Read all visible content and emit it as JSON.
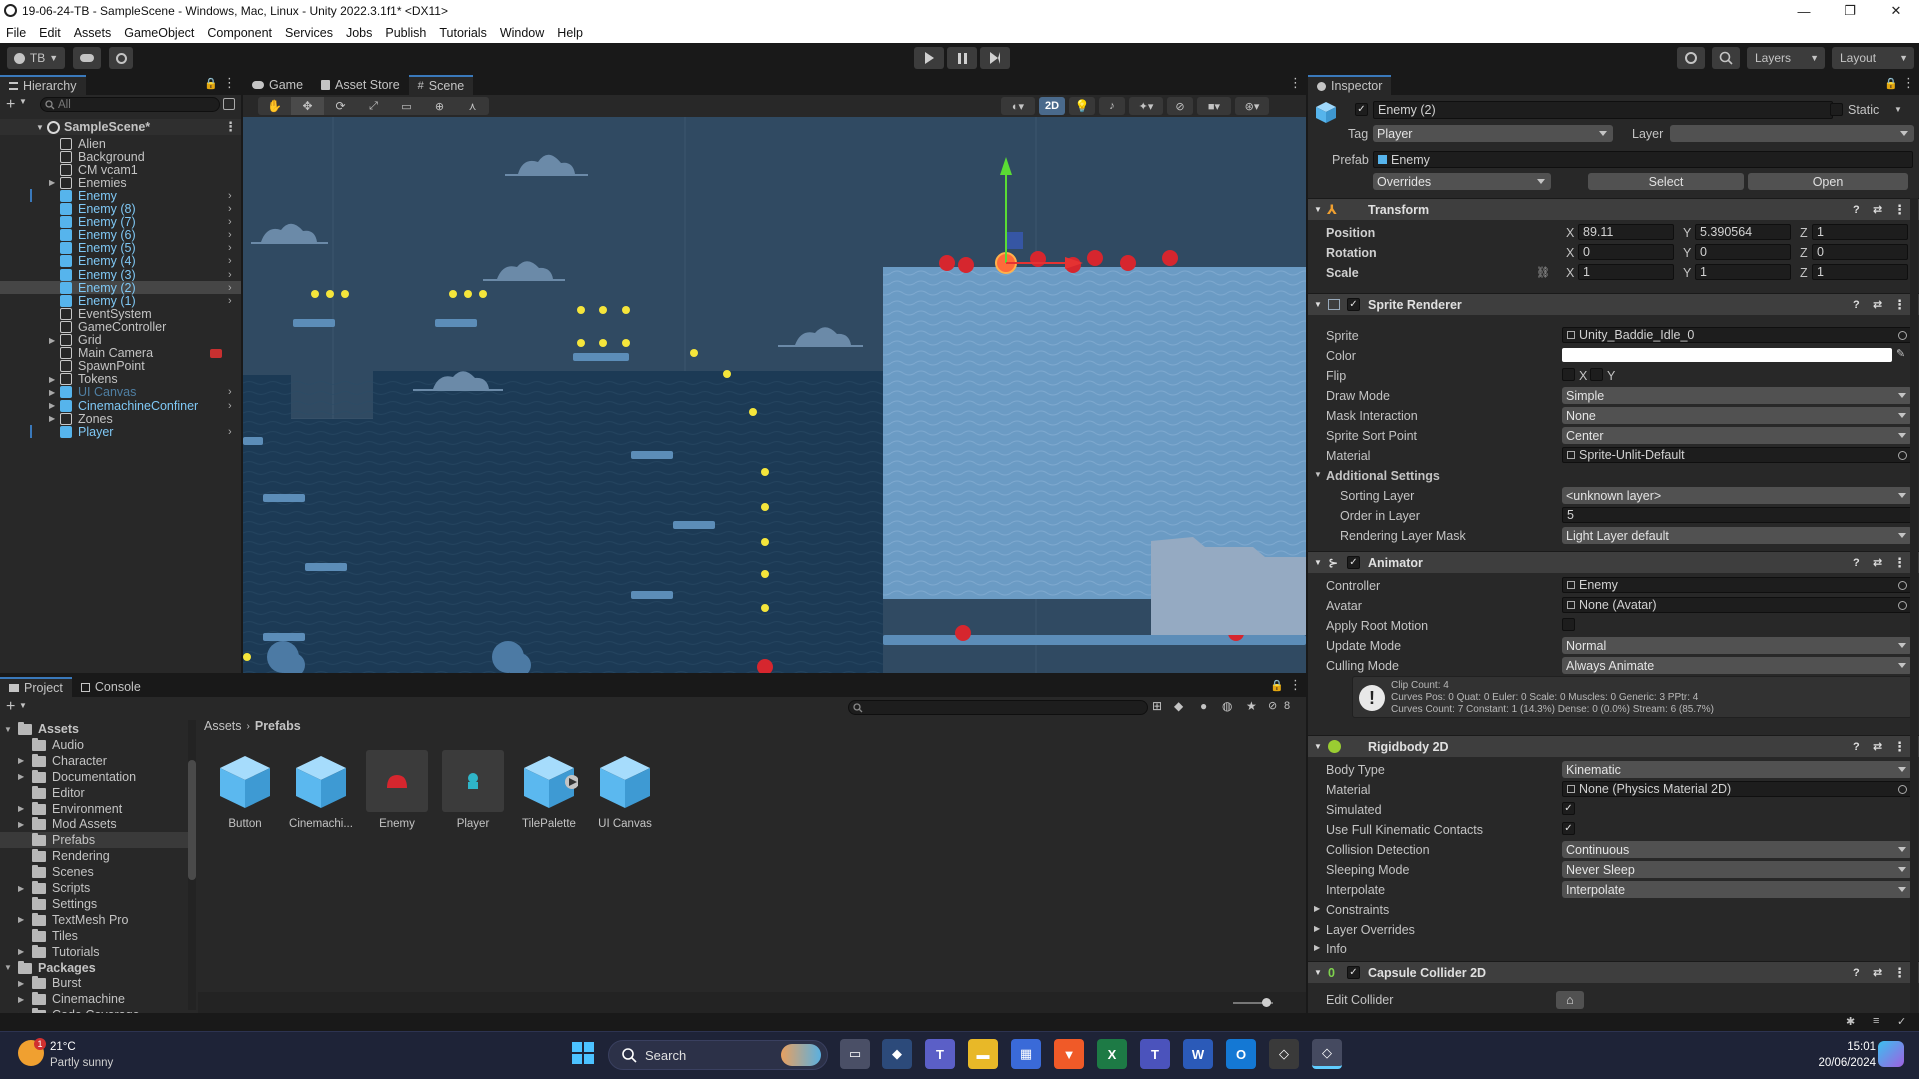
{
  "window": {
    "title": "19-06-24-TB - SampleScene - Windows, Mac, Linux - Unity 2022.3.1f1* <DX11>",
    "controls": [
      "—",
      "❐",
      "✕"
    ]
  },
  "menu": [
    "File",
    "Edit",
    "Assets",
    "GameObject",
    "Component",
    "Services",
    "Jobs",
    "Publish",
    "Tutorials",
    "Window",
    "Help"
  ],
  "toolbar": {
    "account": "TB",
    "layers": "Layers",
    "layout": "Layout"
  },
  "hierarchy": {
    "tab": "Hierarchy",
    "search_placeholder": "All",
    "scene": "SampleScene*",
    "items": [
      {
        "label": "Alien",
        "kind": "go",
        "indent": 1
      },
      {
        "label": "Background",
        "kind": "go",
        "indent": 1
      },
      {
        "label": "CM vcam1",
        "kind": "go",
        "indent": 1
      },
      {
        "label": "Enemies",
        "kind": "go",
        "indent": 1,
        "fold": true
      },
      {
        "label": "Enemy",
        "kind": "prefab",
        "indent": 1,
        "arrow": true,
        "mark": true
      },
      {
        "label": "Enemy (8)",
        "kind": "prefab",
        "indent": 1,
        "arrow": true
      },
      {
        "label": "Enemy (7)",
        "kind": "prefab",
        "indent": 1,
        "arrow": true
      },
      {
        "label": "Enemy (6)",
        "kind": "prefab",
        "indent": 1,
        "arrow": true
      },
      {
        "label": "Enemy (5)",
        "kind": "prefab",
        "indent": 1,
        "arrow": true
      },
      {
        "label": "Enemy (4)",
        "kind": "prefab",
        "indent": 1,
        "arrow": true
      },
      {
        "label": "Enemy (3)",
        "kind": "prefab",
        "indent": 1,
        "arrow": true
      },
      {
        "label": "Enemy (2)",
        "kind": "prefab",
        "indent": 1,
        "arrow": true,
        "selected": true
      },
      {
        "label": "Enemy (1)",
        "kind": "prefab",
        "indent": 1,
        "arrow": true
      },
      {
        "label": "EventSystem",
        "kind": "go",
        "indent": 1
      },
      {
        "label": "GameController",
        "kind": "go",
        "indent": 1
      },
      {
        "label": "Grid",
        "kind": "go",
        "indent": 1,
        "fold": true
      },
      {
        "label": "Main Camera",
        "kind": "go",
        "indent": 1,
        "camera": true
      },
      {
        "label": "SpawnPoint",
        "kind": "go",
        "indent": 1
      },
      {
        "label": "Tokens",
        "kind": "go",
        "indent": 1,
        "fold": true
      },
      {
        "label": "UI Canvas",
        "kind": "prefab-dim",
        "indent": 1,
        "fold": true,
        "arrow": true
      },
      {
        "label": "CinemachineConfiner",
        "kind": "prefab",
        "indent": 1,
        "fold": true,
        "arrow": true
      },
      {
        "label": "Zones",
        "kind": "go",
        "indent": 1,
        "fold": true
      },
      {
        "label": "Player",
        "kind": "prefab",
        "indent": 1,
        "arrow": true,
        "mark": true
      }
    ]
  },
  "scene_view": {
    "tabs": [
      "Game",
      "Asset Store",
      "Scene"
    ],
    "active_tab": "Scene",
    "mode_2d": "2D"
  },
  "inspector": {
    "tab": "Inspector",
    "object_name": "Enemy (2)",
    "static_label": "Static",
    "tag_label": "Tag",
    "tag_value": "Player",
    "layer_label": "Layer",
    "layer_value": "",
    "prefab_label": "Prefab",
    "prefab_value": "Enemy",
    "overrides": "Overrides",
    "select": "Select",
    "open": "Open",
    "transform": {
      "title": "Transform",
      "position_label": "Position",
      "rotation_label": "Rotation",
      "scale_label": "Scale",
      "position": [
        "89.11",
        "5.390564",
        "1"
      ],
      "rotation": [
        "0",
        "0",
        "0"
      ],
      "scale": [
        "1",
        "1",
        "1"
      ],
      "axes": [
        "X",
        "Y",
        "Z"
      ]
    },
    "sprite_renderer": {
      "title": "Sprite Renderer",
      "sprite_label": "Sprite",
      "sprite": "Unity_Baddie_Idle_0",
      "color_label": "Color",
      "flip_label": "Flip",
      "flip_x": "X",
      "flip_y": "Y",
      "draw_mode_label": "Draw Mode",
      "draw_mode": "Simple",
      "mask_label": "Mask Interaction",
      "mask": "None",
      "sort_point_label": "Sprite Sort Point",
      "sort_point": "Center",
      "material_label": "Material",
      "material": "Sprite-Unlit-Default",
      "additional": "Additional Settings",
      "sorting_layer_label": "Sorting Layer",
      "sorting_layer": "<unknown layer>",
      "order_label": "Order in Layer",
      "order": "5",
      "render_mask_label": "Rendering Layer Mask",
      "render_mask": "Light Layer default"
    },
    "animator": {
      "title": "Animator",
      "controller_label": "Controller",
      "controller": "Enemy",
      "avatar_label": "Avatar",
      "avatar": "None (Avatar)",
      "root_motion_label": "Apply Root Motion",
      "update_label": "Update Mode",
      "update": "Normal",
      "culling_label": "Culling Mode",
      "culling": "Always Animate",
      "info_lines": [
        "Clip Count: 4",
        "Curves Pos: 0 Quat: 0 Euler: 0 Scale: 0 Muscles: 0 Generic: 3 PPtr: 4",
        "Curves Count: 7 Constant: 1 (14.3%) Dense: 0 (0.0%) Stream: 6 (85.7%)"
      ]
    },
    "rigidbody": {
      "title": "Rigidbody 2D",
      "body_type_label": "Body Type",
      "body_type": "Kinematic",
      "material_label": "Material",
      "material": "None (Physics Material 2D)",
      "simulated_label": "Simulated",
      "kinematic_label": "Use Full Kinematic Contacts",
      "collision_label": "Collision Detection",
      "collision": "Continuous",
      "sleeping_label": "Sleeping Mode",
      "sleeping": "Never Sleep",
      "interpolate_label": "Interpolate",
      "interpolate": "Interpolate",
      "constraints": "Constraints",
      "layer_overrides": "Layer Overrides",
      "info": "Info"
    },
    "capsule": {
      "title": "Capsule Collider 2D",
      "edit_label": "Edit Collider"
    }
  },
  "project": {
    "tabs": [
      "Project",
      "Console"
    ],
    "breadcrumb": [
      "Assets",
      "Prefabs"
    ],
    "hidden_count": "8",
    "tree": [
      {
        "label": "Assets",
        "bold": true,
        "indent": 0,
        "fold": true
      },
      {
        "label": "Audio",
        "indent": 1
      },
      {
        "label": "Character",
        "indent": 1,
        "fold": true
      },
      {
        "label": "Documentation",
        "indent": 1,
        "fold": true
      },
      {
        "label": "Editor",
        "indent": 1
      },
      {
        "label": "Environment",
        "indent": 1,
        "fold": true
      },
      {
        "label": "Mod Assets",
        "indent": 1,
        "fold": true
      },
      {
        "label": "Prefabs",
        "indent": 1,
        "selected": true
      },
      {
        "label": "Rendering",
        "indent": 1
      },
      {
        "label": "Scenes",
        "indent": 1
      },
      {
        "label": "Scripts",
        "indent": 1,
        "fold": true
      },
      {
        "label": "Settings",
        "indent": 1
      },
      {
        "label": "TextMesh Pro",
        "indent": 1,
        "fold": true
      },
      {
        "label": "Tiles",
        "indent": 1
      },
      {
        "label": "Tutorials",
        "indent": 1,
        "fold": true
      },
      {
        "label": "Packages",
        "bold": true,
        "indent": 0,
        "fold": true
      },
      {
        "label": "Burst",
        "indent": 1,
        "fold": true
      },
      {
        "label": "Cinemachine",
        "indent": 1,
        "fold": true
      },
      {
        "label": "Code Coverage",
        "indent": 1,
        "fold": true
      }
    ],
    "assets": [
      {
        "label": "Button",
        "type": "cube"
      },
      {
        "label": "Cinemachi...",
        "type": "cube"
      },
      {
        "label": "Enemy",
        "type": "enemy"
      },
      {
        "label": "Player",
        "type": "player"
      },
      {
        "label": "TilePalette",
        "type": "cube-play"
      },
      {
        "label": "UI Canvas",
        "type": "cube"
      }
    ]
  },
  "taskbar": {
    "weather_temp": "21°C",
    "weather_desc": "Partly sunny",
    "weather_badge": "1",
    "search": "Search",
    "time": "15:01",
    "date": "20/06/2024"
  },
  "colors": {
    "accent": "#3a79bb",
    "prefab": "#56b4ec",
    "enemy": "#d6262e",
    "token": "#f5e53b",
    "sky": "#304a62",
    "water": "#6b9bc4",
    "taskbar": "#1e2337"
  }
}
